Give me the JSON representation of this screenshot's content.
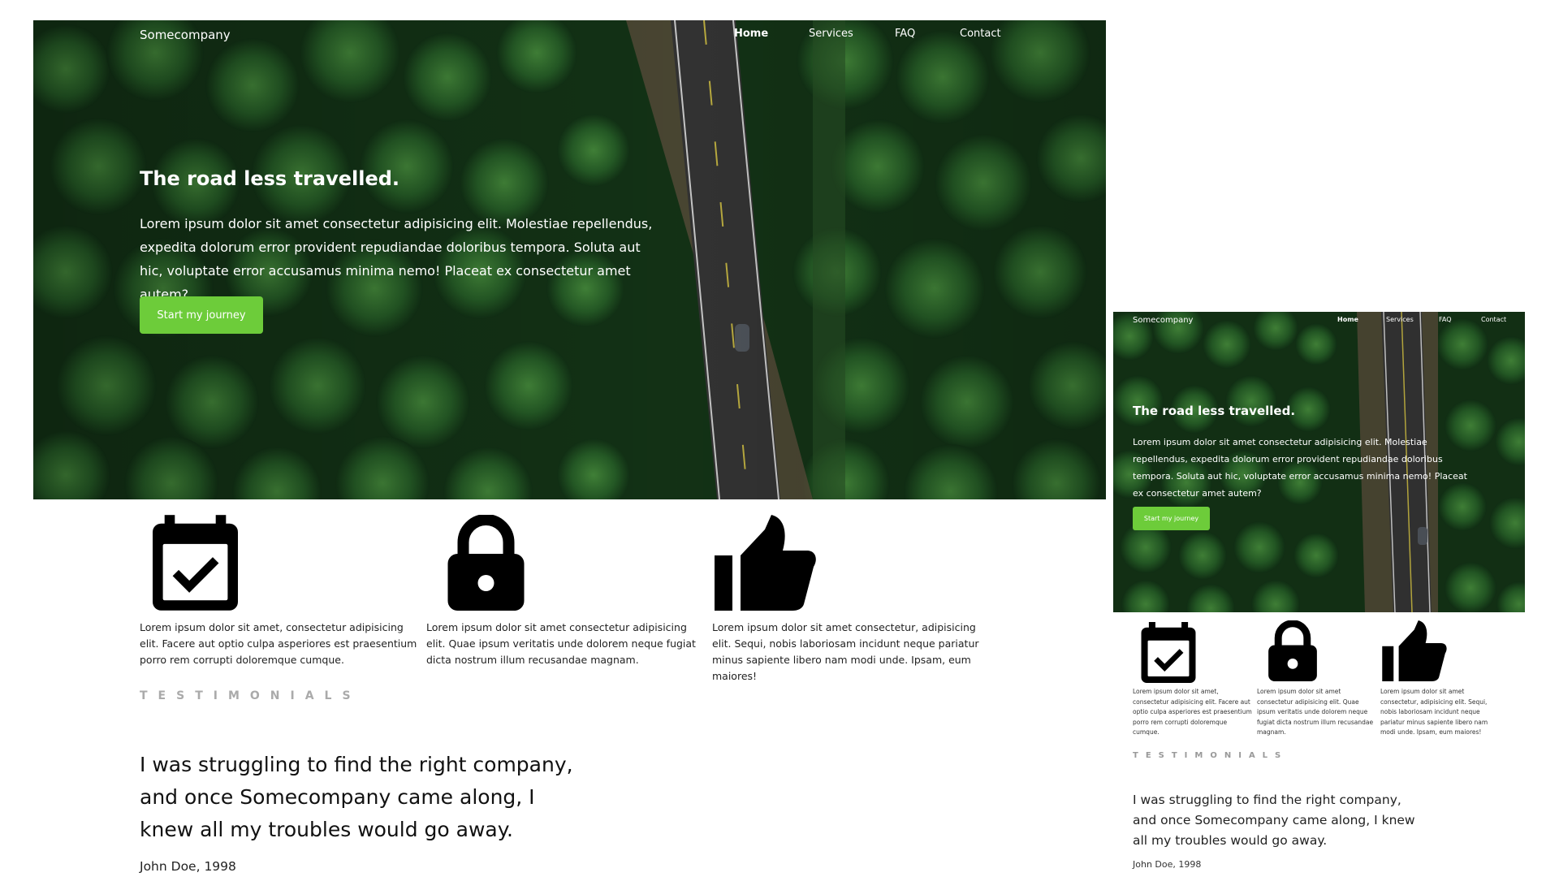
{
  "brand": "Somecompany",
  "nav": [
    {
      "label": "Home",
      "active": true
    },
    {
      "label": "Services",
      "active": false
    },
    {
      "label": "FAQ",
      "active": false
    },
    {
      "label": "Contact",
      "active": false
    }
  ],
  "hero": {
    "title": "The road less travelled.",
    "text": "Lorem ipsum dolor sit amet consectetur adipisicing elit. Molestiae repellendus, expedita dolorum error provident repudiandae doloribus tempora. Soluta aut hic, voluptate error accusamus minima nemo! Placeat ex consectetur amet autem?",
    "cta": "Start my journey"
  },
  "features": [
    {
      "icon": "calendar-check-icon",
      "text": "Lorem ipsum dolor sit amet, consectetur adipisicing elit. Facere aut optio culpa asperiores est praesentium porro rem corrupti doloremque cumque."
    },
    {
      "icon": "lock-icon",
      "text": "Lorem ipsum dolor sit amet consectetur adipisicing elit. Quae ipsum veritatis unde dolorem neque fugiat dicta nostrum illum recusandae magnam."
    },
    {
      "icon": "thumbs-up-icon",
      "text": "Lorem ipsum dolor sit amet consectetur, adipisicing elit. Sequi, nobis laboriosam incidunt neque pariatur minus sapiente libero nam modi unde. Ipsam, eum maiores!"
    }
  ],
  "testimonials": {
    "label": "TESTIMONIALS",
    "quote": "I was struggling to find the right company, and once Somecompany came along, I knew all my troubles would go away.",
    "author": "John Doe, 1998"
  },
  "colors": {
    "accent": "#6dcc3a",
    "forest": "#1f4a22",
    "road": "#3b3b3b"
  }
}
